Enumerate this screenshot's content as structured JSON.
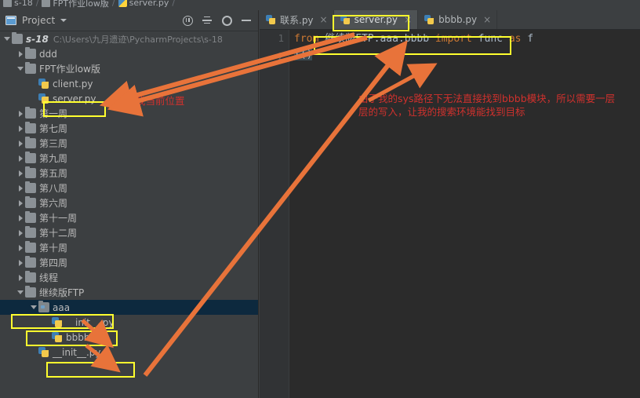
{
  "breadcrumb": {
    "items": [
      {
        "label": "s-18",
        "icon": "folder-icon"
      },
      {
        "label": "FPT作业low版",
        "icon": "folder-icon"
      },
      {
        "label": "server.py",
        "icon": "python-file-icon"
      }
    ]
  },
  "project_panel": {
    "title": "Project",
    "icons": {
      "project": "project-icon",
      "dropdown": "chevron-down-icon",
      "collapse_all": "collapse-all-icon",
      "expand_all": "expand-all-icon",
      "settings": "gear-icon",
      "minimize": "minimize-icon"
    },
    "tree": [
      {
        "label": "s-18",
        "sub": "C:\\Users\\九月遗迹\\PycharmProjects\\s-18",
        "indent": 0,
        "state": "expanded",
        "icon": "folder-icon",
        "bold": true
      },
      {
        "label": "ddd",
        "sub": "",
        "indent": 1,
        "state": "collapsed",
        "icon": "folder-icon"
      },
      {
        "label": "FPT作业low版",
        "sub": "",
        "indent": 1,
        "state": "expanded",
        "icon": "folder-icon"
      },
      {
        "label": "client.py",
        "sub": "",
        "indent": 2,
        "state": "leaf",
        "icon": "python-file-icon"
      },
      {
        "label": "server.py",
        "sub": "",
        "indent": 2,
        "state": "leaf",
        "icon": "python-file-icon"
      },
      {
        "label": "第一周",
        "sub": "",
        "indent": 1,
        "state": "collapsed",
        "icon": "folder-icon"
      },
      {
        "label": "第七周",
        "sub": "",
        "indent": 1,
        "state": "collapsed",
        "icon": "folder-icon"
      },
      {
        "label": "第三周",
        "sub": "",
        "indent": 1,
        "state": "collapsed",
        "icon": "folder-icon"
      },
      {
        "label": "第九周",
        "sub": "",
        "indent": 1,
        "state": "collapsed",
        "icon": "folder-icon"
      },
      {
        "label": "第五周",
        "sub": "",
        "indent": 1,
        "state": "collapsed",
        "icon": "folder-icon"
      },
      {
        "label": "第八周",
        "sub": "",
        "indent": 1,
        "state": "collapsed",
        "icon": "folder-icon"
      },
      {
        "label": "第六周",
        "sub": "",
        "indent": 1,
        "state": "collapsed",
        "icon": "folder-icon"
      },
      {
        "label": "第十一周",
        "sub": "",
        "indent": 1,
        "state": "collapsed",
        "icon": "folder-icon"
      },
      {
        "label": "第十二周",
        "sub": "",
        "indent": 1,
        "state": "collapsed",
        "icon": "folder-icon"
      },
      {
        "label": "第十周",
        "sub": "",
        "indent": 1,
        "state": "collapsed",
        "icon": "folder-icon"
      },
      {
        "label": "第四周",
        "sub": "",
        "indent": 1,
        "state": "collapsed",
        "icon": "folder-icon"
      },
      {
        "label": "线程",
        "sub": "",
        "indent": 1,
        "state": "collapsed",
        "icon": "folder-icon"
      },
      {
        "label": "继续版FTP",
        "sub": "",
        "indent": 1,
        "state": "expanded",
        "icon": "folder-icon"
      },
      {
        "label": "aaa",
        "sub": "",
        "indent": 2,
        "state": "expanded",
        "icon": "folder-icon",
        "selected": true
      },
      {
        "label": "__init__.py",
        "sub": "",
        "indent": 3,
        "state": "leaf",
        "icon": "python-file-icon"
      },
      {
        "label": "bbbb.py",
        "sub": "",
        "indent": 3,
        "state": "leaf",
        "icon": "python-file-icon"
      },
      {
        "label": "__init__.py",
        "sub": "",
        "indent": 2,
        "state": "leaf",
        "icon": "python-file-icon"
      }
    ]
  },
  "editor": {
    "tabs": [
      {
        "label": "联系.py",
        "active": false,
        "close": "×"
      },
      {
        "label": "server.py",
        "active": true,
        "close": "×"
      },
      {
        "label": "bbbb.py",
        "active": false,
        "close": "×"
      }
    ],
    "line_numbers": [
      "1",
      "2"
    ],
    "code": {
      "line1_kw_from": "from",
      "line1_module": " 继续版FTP.aaa.bbbb ",
      "line1_kw_import": "import",
      "line1_func": " func ",
      "line1_kw_as": "as",
      "line1_alias": " f",
      "line2": "f()"
    }
  },
  "annotations": {
    "sidebar_note": "我当前位置",
    "editor_note": "由于我的sys路径下无法直接找到bbbb模块，所以需要一层层的写入，让我的搜索环境能找到目标",
    "highlight_color": "#ffff2e",
    "arrow_color": "#e8733a",
    "note_color": "#d0312d"
  }
}
